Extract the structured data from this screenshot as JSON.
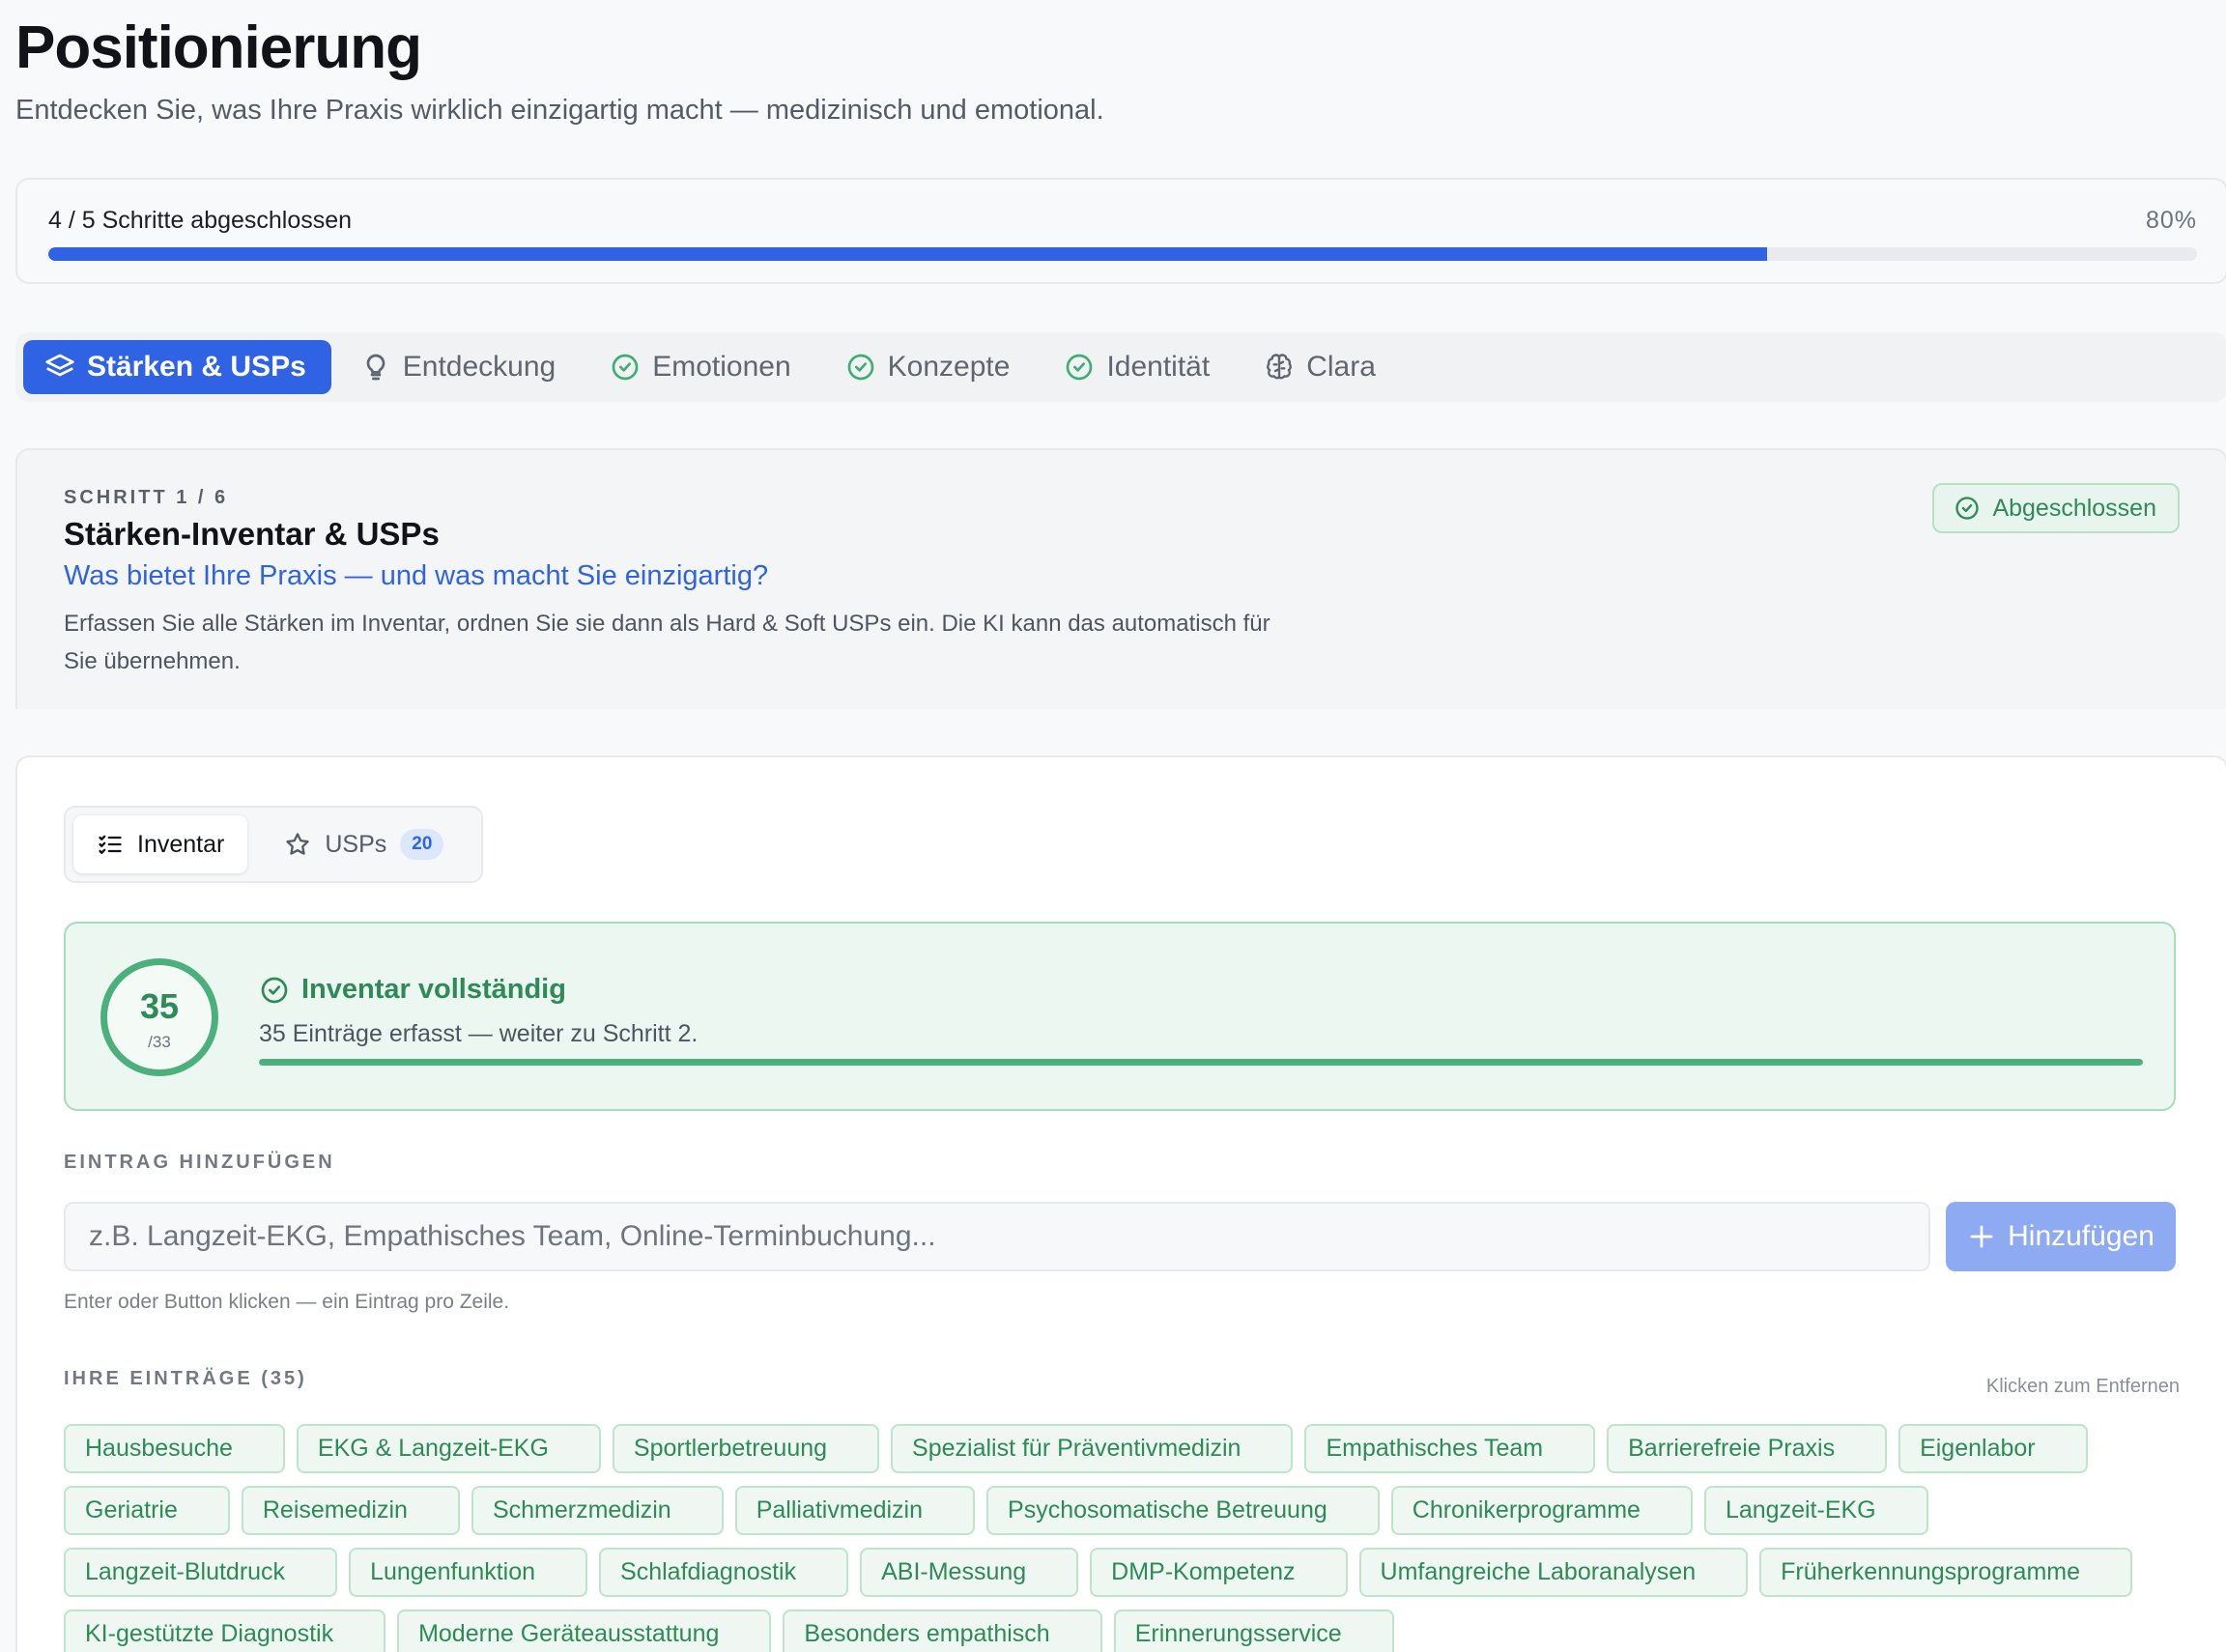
{
  "header": {
    "title": "Positionierung",
    "subtitle": "Entdecken Sie, was Ihre Praxis wirklich einzigartig macht — medizinisch und emotional."
  },
  "progress": {
    "label": "4 / 5 Schritte abgeschlossen",
    "percent_text": "80%",
    "fraction": 0.8
  },
  "step_tabs": [
    {
      "label": "Stärken & USPs",
      "icon": "layers-icon",
      "active": true
    },
    {
      "label": "Entdeckung",
      "icon": "lightbulb-icon",
      "active": false
    },
    {
      "label": "Emotionen",
      "icon": "check-circle-icon",
      "active": false
    },
    {
      "label": "Konzepte",
      "icon": "check-circle-icon",
      "active": false
    },
    {
      "label": "Identität",
      "icon": "check-circle-icon",
      "active": false
    },
    {
      "label": "Clara",
      "icon": "brain-icon",
      "active": false
    }
  ],
  "step": {
    "kicker": "SCHRITT 1 / 6",
    "title": "Stärken-Inventar & USPs",
    "question": "Was bietet Ihre Praxis — und was macht Sie einzigartig?",
    "description": "Erfassen Sie alle Stärken im Inventar, ordnen Sie sie dann als Hard & Soft USPs ein. Die KI kann das automatisch für Sie übernehmen.",
    "badge": "Abgeschlossen"
  },
  "sub_tabs": {
    "inventory_label": "Inventar",
    "usps_label": "USPs",
    "usps_count": "20"
  },
  "status": {
    "count": "35",
    "target": "/33",
    "title": "Inventar vollständig",
    "text": "35 Einträge erfasst — weiter zu Schritt 2.",
    "fraction": 1.0
  },
  "add_entry": {
    "section_label": "EINTRAG HINZUFÜGEN",
    "placeholder": "z.B. Langzeit-EKG, Empathisches Team, Online-Terminbuchung...",
    "button_label": "Hinzufügen",
    "hint": "Enter oder Button klicken — ein Eintrag pro Zeile."
  },
  "entries": {
    "section_label": "IHRE EINTRÄGE (35)",
    "remove_hint": "Klicken zum Entfernen",
    "items": [
      "Hausbesuche",
      "EKG & Langzeit-EKG",
      "Sportlerbetreuung",
      "Spezialist für Präventivmedizin",
      "Empathisches Team",
      "Barrierefreie Praxis",
      "Eigenlabor",
      "Geriatrie",
      "Reisemedizin",
      "Schmerzmedizin",
      "Palliativmedizin",
      "Psychosomatische Betreuung",
      "Chronikerprogramme",
      "Langzeit-EKG",
      "Langzeit-Blutdruck",
      "Lungenfunktion",
      "Schlafdiagnostik",
      "ABI-Messung",
      "DMP-Kompetenz",
      "Umfangreiche Laboranalysen",
      "Früherkennungsprogramme",
      "KI-gestützte Diagnostik",
      "Moderne Geräteausstattung",
      "Besonders empathisch",
      "Erinnerungsservice"
    ]
  },
  "colors": {
    "accent": "#2f63e4",
    "success": "#2e8a57",
    "success_bg": "#ebf7f0"
  }
}
